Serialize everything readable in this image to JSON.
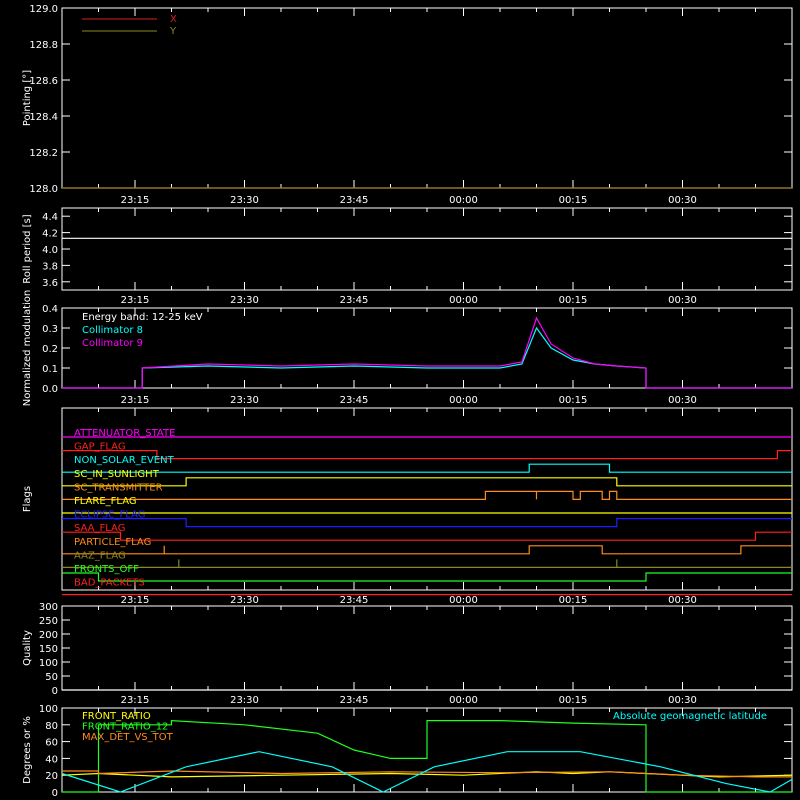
{
  "x_tick_labels": [
    "23:15",
    "23:30",
    "23:45",
    "00:00",
    "00:15",
    "00:30"
  ],
  "chart_data": [
    {
      "type": "line",
      "ylabel": "Pointing [°]",
      "ylim": [
        128.0,
        129.0
      ],
      "y_ticks": [
        "128.0",
        "128.2",
        "128.4",
        "128.6",
        "128.8",
        "129.0"
      ],
      "legend": [
        {
          "label": "X",
          "color": "#d22020"
        },
        {
          "label": "Y",
          "color": "#8a8a20"
        }
      ],
      "legend_placement": "top-left",
      "series": [
        {
          "name": "X",
          "color": "#d22020",
          "x": [
            "23:05",
            "00:45"
          ],
          "values": [
            128.0,
            128.0
          ]
        },
        {
          "name": "Y",
          "color": "#8a8a20",
          "x": [
            "23:05",
            "00:45"
          ],
          "values": [
            128.0,
            128.0
          ]
        }
      ]
    },
    {
      "type": "line",
      "ylabel": "Roll period [s]",
      "ylim": [
        3.5,
        4.5
      ],
      "y_ticks": [
        "3.6",
        "3.8",
        "4.0",
        "4.2",
        "4.4"
      ],
      "series": [
        {
          "color": "#ffffff",
          "x": [
            "23:05",
            "00:45"
          ],
          "values": [
            4.13,
            4.13
          ]
        }
      ]
    },
    {
      "type": "line",
      "ylabel": "Normalized modulation",
      "ylim": [
        0.0,
        0.4
      ],
      "y_ticks": [
        "0.0",
        "0.1",
        "0.2",
        "0.3",
        "0.4"
      ],
      "annotation": "Energy band: 12-25 keV",
      "legend": [
        {
          "label": "Collimator 8",
          "color": "#00ffff"
        },
        {
          "label": "Collimator 9",
          "color": "#ff00ff"
        }
      ],
      "legend_placement": "top-left",
      "series": [
        {
          "name": "Collimator 8",
          "color": "#00ffff",
          "x": [
            "23:05",
            "23:16",
            "23:16",
            "23:25",
            "23:35",
            "23:45",
            "23:55",
            "00:05",
            "00:08",
            "00:10",
            "00:12",
            "00:15",
            "00:18",
            "00:21",
            "00:25",
            "00:25",
            "00:45"
          ],
          "values": [
            0.0,
            0.0,
            0.1,
            0.11,
            0.1,
            0.11,
            0.1,
            0.1,
            0.12,
            0.3,
            0.2,
            0.14,
            0.12,
            0.11,
            0.1,
            0.0,
            0.0
          ]
        },
        {
          "name": "Collimator 9",
          "color": "#ff00ff",
          "x": [
            "23:05",
            "23:16",
            "23:16",
            "23:25",
            "23:35",
            "23:45",
            "23:55",
            "00:05",
            "00:08",
            "00:10",
            "00:12",
            "00:15",
            "00:18",
            "00:21",
            "00:25",
            "00:25",
            "00:45"
          ],
          "values": [
            0.0,
            0.0,
            0.1,
            0.12,
            0.11,
            0.12,
            0.11,
            0.11,
            0.13,
            0.35,
            0.22,
            0.15,
            0.12,
            0.11,
            0.1,
            0.0,
            0.0
          ]
        }
      ]
    },
    {
      "type": "line",
      "ylabel": "Flags",
      "flags": [
        {
          "name": "ATTENUATOR_STATE",
          "color": "#ff00ff",
          "transitions": [
            [
              "23:05",
              1
            ],
            [
              "00:45",
              1
            ]
          ]
        },
        {
          "name": "GAP_FLAG",
          "color": "#ff2020",
          "transitions": [
            [
              "23:05",
              1
            ],
            [
              "23:18",
              0
            ],
            [
              "00:43",
              1
            ],
            [
              "00:45",
              1
            ]
          ]
        },
        {
          "name": "NON_SOLAR_EVENT",
          "color": "#00ffff",
          "transitions": [
            [
              "23:05",
              0
            ],
            [
              "00:09",
              1
            ],
            [
              "00:20",
              0
            ],
            [
              "00:45",
              0
            ]
          ]
        },
        {
          "name": "SC_IN_SUNLIGHT",
          "color": "#ffff00",
          "transitions": [
            [
              "23:05",
              0
            ],
            [
              "23:22",
              1
            ],
            [
              "00:21",
              0
            ],
            [
              "00:45",
              0
            ]
          ]
        },
        {
          "name": "SC_TRANSMITTER",
          "color": "#ff8c1a",
          "transitions": [
            [
              "23:05",
              0
            ],
            [
              "00:03",
              1
            ],
            [
              "00:10",
              0
            ],
            [
              "00:10",
              1
            ],
            [
              "00:15",
              0
            ],
            [
              "00:16",
              1
            ],
            [
              "00:19",
              0
            ],
            [
              "00:20",
              1
            ],
            [
              "00:21",
              0
            ],
            [
              "00:45",
              0
            ]
          ]
        },
        {
          "name": "FLARE_FLAG",
          "color": "#ffff00",
          "transitions": [
            [
              "23:05",
              0
            ],
            [
              "00:45",
              0
            ]
          ]
        },
        {
          "name": "ECLIPSE_FLAG",
          "color": "#2020ff",
          "transitions": [
            [
              "23:05",
              1
            ],
            [
              "23:22",
              0
            ],
            [
              "00:21",
              1
            ],
            [
              "00:45",
              1
            ]
          ]
        },
        {
          "name": "SAA_FLAG",
          "color": "#ff2020",
          "transitions": [
            [
              "23:05",
              1
            ],
            [
              "23:13",
              0
            ],
            [
              "00:40",
              1
            ],
            [
              "00:45",
              1
            ]
          ]
        },
        {
          "name": "PARTICLE_FLAG",
          "color": "#ff8c1a",
          "transitions": [
            [
              "23:05",
              0
            ],
            [
              "23:19",
              1
            ],
            [
              "23:19",
              0
            ],
            [
              "00:09",
              1
            ],
            [
              "00:19",
              0
            ],
            [
              "00:38",
              1
            ],
            [
              "00:45",
              1
            ]
          ]
        },
        {
          "name": "AAZ_FLAG",
          "color": "#8a8a20",
          "transitions": [
            [
              "23:05",
              0
            ],
            [
              "23:21",
              1
            ],
            [
              "23:21",
              0
            ],
            [
              "00:21",
              1
            ],
            [
              "00:21",
              0
            ],
            [
              "00:45",
              0
            ]
          ]
        },
        {
          "name": "FRONTS_OFF",
          "color": "#20ff20",
          "transitions": [
            [
              "23:05",
              1
            ],
            [
              "23:10",
              0
            ],
            [
              "00:25",
              1
            ],
            [
              "00:45",
              1
            ]
          ]
        },
        {
          "name": "BAD_PACKETS",
          "color": "#ff2020",
          "transitions": [
            [
              "23:05",
              0
            ],
            [
              "00:45",
              0
            ]
          ]
        }
      ]
    },
    {
      "type": "line",
      "ylabel": "Quality",
      "ylim": [
        0,
        300
      ],
      "y_ticks": [
        "0",
        "50",
        "100",
        "150",
        "200",
        "250",
        "300"
      ],
      "series": [
        {
          "color": "#ffffff",
          "x": [
            "23:05",
            "00:45"
          ],
          "values": [
            0,
            0
          ]
        }
      ]
    },
    {
      "type": "line",
      "ylabel": "Degrees or %",
      "ylim": [
        0,
        100
      ],
      "y_ticks": [
        "0",
        "20",
        "40",
        "60",
        "80",
        "100"
      ],
      "legend": [
        {
          "label": "FRONT_RATIO",
          "color": "#ffff00"
        },
        {
          "label": "FRONT_RATIO_12",
          "color": "#20ff20"
        },
        {
          "label": "MAX_DET_VS_TOT",
          "color": "#ff8c1a"
        }
      ],
      "legend_placement": "top-left",
      "annotation": "Absolute geomagnetic latitude",
      "annotation_color": "#00ffff",
      "series": [
        {
          "name": "FRONT_RATIO",
          "color": "#ffff00",
          "x": [
            "23:05",
            "23:10",
            "23:20",
            "23:35",
            "23:50",
            "00:00",
            "00:10",
            "00:15",
            "00:20",
            "00:25",
            "00:35",
            "00:45"
          ],
          "values": [
            20,
            22,
            18,
            20,
            22,
            20,
            24,
            22,
            24,
            22,
            18,
            20
          ]
        },
        {
          "name": "FRONT_RATIO_12",
          "color": "#20ff20",
          "x": [
            "23:05",
            "23:10",
            "23:10",
            "23:16",
            "23:16",
            "23:20",
            "23:20",
            "23:30",
            "23:40",
            "23:45",
            "23:50",
            "23:55",
            "23:55",
            "00:05",
            "00:15",
            "00:25",
            "00:25",
            "00:45"
          ],
          "values": [
            0,
            0,
            80,
            80,
            80,
            80,
            85,
            80,
            70,
            50,
            40,
            40,
            85,
            85,
            82,
            80,
            0,
            0
          ]
        },
        {
          "name": "MAX_DET_VS_TOT",
          "color": "#ff8c1a",
          "x": [
            "23:05",
            "23:10",
            "23:10",
            "23:20",
            "23:35",
            "23:50",
            "00:05",
            "00:20",
            "00:30",
            "00:40",
            "00:45"
          ],
          "values": [
            25,
            25,
            22,
            25,
            22,
            24,
            23,
            24,
            20,
            18,
            18
          ]
        },
        {
          "name": "Absolute geomagnetic latitude",
          "color": "#00ffff",
          "x": [
            "23:05",
            "23:13",
            "23:22",
            "23:32",
            "23:42",
            "23:49",
            "23:56",
            "00:06",
            "00:16",
            "00:27",
            "00:36",
            "00:42",
            "00:45"
          ],
          "values": [
            22,
            0,
            30,
            48,
            30,
            0,
            30,
            48,
            48,
            30,
            10,
            0,
            15
          ]
        }
      ]
    }
  ]
}
